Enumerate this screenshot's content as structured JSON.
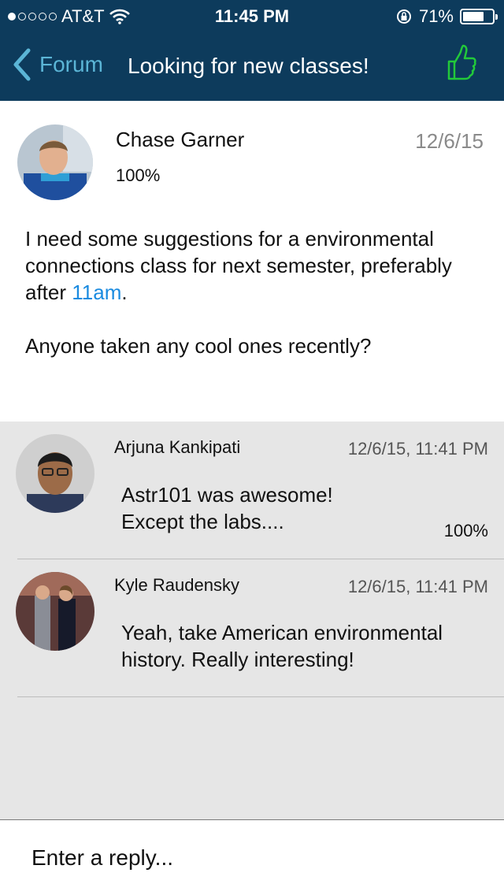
{
  "status_bar": {
    "carrier": "AT&T",
    "time": "11:45 PM",
    "battery": "71%",
    "battery_level": 0.71
  },
  "nav": {
    "back_label": "Forum",
    "title": "Looking for new classes!"
  },
  "post": {
    "author": "Chase Garner",
    "score": "100%",
    "date": "12/6/15",
    "body_before_link": "I need some suggestions for a environmental connections class for next semester, preferably after ",
    "body_link": "11am",
    "body_after_link": ".",
    "body_p2": "Anyone taken any cool ones recently?"
  },
  "comments": [
    {
      "author": "Arjuna Kankipati",
      "date": "12/6/15, 11:41 PM",
      "line1": "Astr101 was awesome!",
      "line2": "Except the labs....",
      "score": "100%"
    },
    {
      "author": "Kyle Raudensky",
      "date": "12/6/15, 11:41 PM",
      "line1": "Yeah, take American environmental",
      "line2": "history. Really interesting!",
      "score": ""
    }
  ],
  "reply": {
    "placeholder": "Enter a reply..."
  },
  "colors": {
    "header": "#0d3b5c",
    "accent": "#5bb5d6",
    "like": "#22c93a",
    "link": "#1a8be0"
  }
}
